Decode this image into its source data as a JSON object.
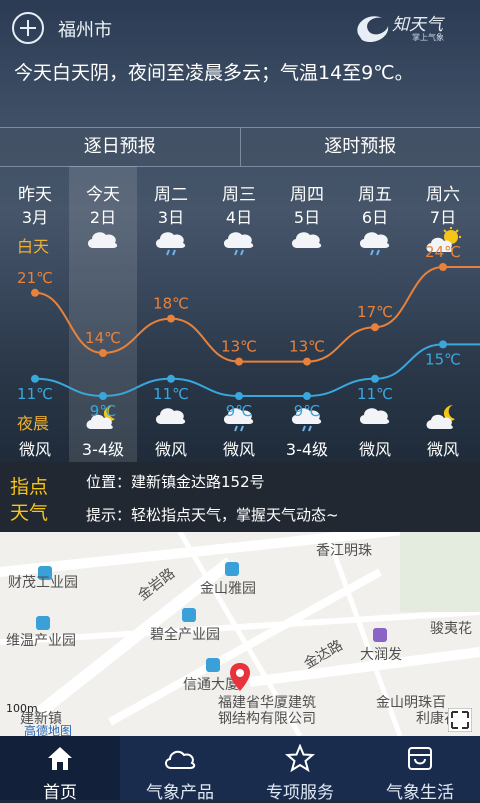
{
  "header": {
    "city": "福州市",
    "logo_text": "知天气",
    "logo_sub": "掌上气象"
  },
  "summary": "今天白天阴，夜间至凌晨多云；气温14至9℃。",
  "tabs": [
    "逐日预报",
    "逐时预报"
  ],
  "labels": {
    "daytime": "白天",
    "night": "夜晨"
  },
  "days": [
    {
      "name": "昨天",
      "date": "3月",
      "day_icon": "",
      "night_icon": "",
      "high": "21℃",
      "low": "11℃",
      "wind": "微风"
    },
    {
      "name": "今天",
      "date": "2日",
      "day_icon": "cloud-icon",
      "night_icon": "partly-cloudy-night-icon",
      "high": "14℃",
      "low": "9℃",
      "wind": "3-4级"
    },
    {
      "name": "周二",
      "date": "3日",
      "day_icon": "light-rain-icon",
      "night_icon": "cloud-icon",
      "high": "18℃",
      "low": "11℃",
      "wind": "微风"
    },
    {
      "name": "周三",
      "date": "4日",
      "day_icon": "light-rain-icon",
      "night_icon": "light-rain-icon",
      "high": "13℃",
      "low": "9℃",
      "wind": "微风"
    },
    {
      "name": "周四",
      "date": "5日",
      "day_icon": "cloud-icon",
      "night_icon": "light-rain-icon",
      "high": "13℃",
      "low": "9℃",
      "wind": "3-4级"
    },
    {
      "name": "周五",
      "date": "6日",
      "day_icon": "light-rain-icon",
      "night_icon": "cloud-icon",
      "high": "17℃",
      "low": "11℃",
      "wind": "微风"
    },
    {
      "name": "周六",
      "date": "7日",
      "day_icon": "partly-sunny-icon",
      "night_icon": "partly-cloudy-night-icon",
      "high": "24℃",
      "low": "15℃",
      "wind": "微风"
    }
  ],
  "colors": {
    "high_line": "#e8813a",
    "low_line": "#3aa7dc",
    "label_accent": "#f0b030",
    "logo_accent": "#f5c518"
  },
  "info": {
    "logo_line1": "指点",
    "logo_line2": "天气",
    "location": "位置：建新镇金达路152号",
    "tip": "提示：轻松指点天气，掌握天气动态~"
  },
  "map": {
    "labels": [
      "财茂工业园",
      "金岩路",
      "金山雅园",
      "维温产业园",
      "碧全产业园",
      "信通大厦",
      "福建省华厦建筑",
      "钢结构有限公司",
      "金达路",
      "大润发",
      "香江明珠",
      "骏夷花",
      "金山明珠百",
      "利康花",
      "建新镇",
      "高德地图"
    ],
    "scale": "100m"
  },
  "nav": [
    "首页",
    "气象产品",
    "专项服务",
    "气象生活"
  ]
}
